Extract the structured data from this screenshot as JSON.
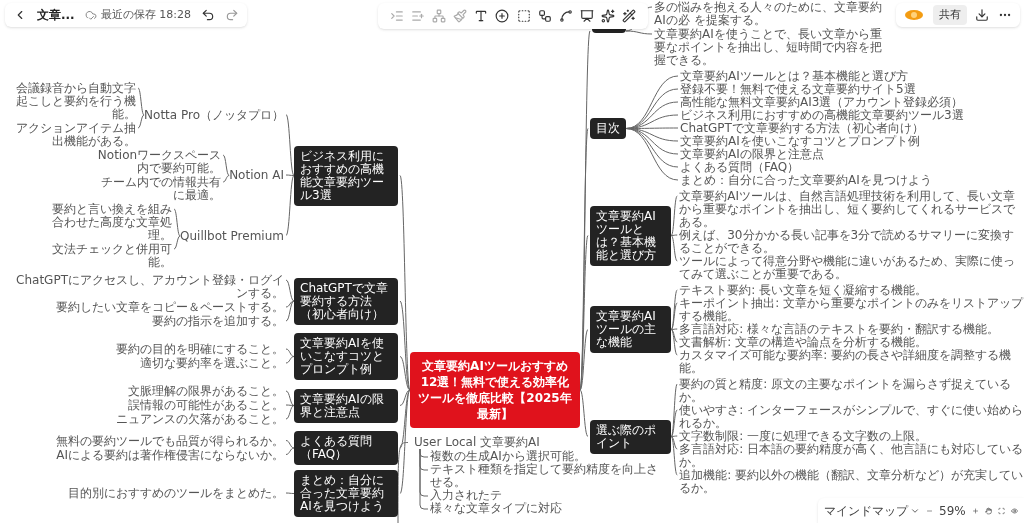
{
  "header": {
    "title": "文章...",
    "save_status": "最近の保存 18:28"
  },
  "account": {
    "share": "共有"
  },
  "mindmap": {
    "root": "文章要約AIツールおすすめ12選！無料で使える効率化ツールを徹底比較【2025年最新】",
    "right_branches": [
      {
        "leaves": [
          "多の悩みを抱える人々のために、文章要約AIの必 を提案する。",
          "文章要約AIを使うことで、長い文章から重要なポイントを抽出し、短時間で内容を把握できる。"
        ]
      },
      {
        "label": "目次",
        "leaves": [
          "文章要約AIツールとは？基本機能と選び方",
          "登録不要！無料で使える文章要約サイト5選",
          "高性能な無料文章要約AI3選（アカウント登録必須）",
          "ビジネス利用におすすめの高機能文章要約ツール3選",
          "ChatGPTで文章要約する方法（初心者向け）",
          "文章要約AIを使いこなすコツとプロンプト例",
          "文章要約AIの限界と注意点",
          "よくある質問（FAQ）",
          "まとめ：自分に合った文章要約AIを見つけよう"
        ]
      },
      {
        "label": "文章要約AIツールとは？基本機能と選び方",
        "leaves": [
          "文章要約AIツールは、自然言語処理技術を利用して、長い文章から重要なポイントを抽出し、短く要約してくれるサービスである。",
          "例えば、30分かかる長い記事を3分で読めるサマリーに変換することができる。",
          "ツールによって得意分野や機能に違いがあるため、実際に使ってみて選ぶことが重要である。"
        ]
      },
      {
        "label": "文章要約AIツールの主な機能",
        "leaves": [
          "テキスト要約: 長い文章を短く凝縮する機能。",
          "キーポイント抽出: 文章から重要なポイントのみをリストアップする機能。",
          "多言語対応: 様々な言語のテキストを要約・翻訳する機能。",
          "文書解析: 文章の構造や論点を分析する機能。",
          "カスタマイズ可能な要約率: 要約の長さや詳細度を調整する機能。"
        ]
      },
      {
        "label": "選ぶ際のポイント",
        "leaves": [
          "要約の質と精度: 原文の主要なポイントを漏らさず捉えているか。",
          "使いやすさ: インターフェースがシンプルで、すぐに使い始められるか。",
          "文字数制限: 一度に処理できる文字数の上限。",
          "多言語対応: 日本語の要約精度が高く、他言語にも対応しているか。",
          "追加機能: 要約以外の機能（翻訳、文章分析など）が充実しているか。"
        ]
      }
    ],
    "left_branches": [
      {
        "label": "ビジネス利用におすすめの高機能文章要約ツール3選",
        "leaves": [
          {
            "label": "Notta Pro（ノッタプロ）",
            "leaves": [
              "会議録音から自動文字起こしと要約を行う機能。",
              "アクションアイテム抽出機能がある。"
            ]
          },
          {
            "label": "Notion AI",
            "leaves": [
              "Notionワークスペース内で要約可能。",
              "チーム内での情報共有に最適。"
            ]
          },
          {
            "label": "Quillbot Premium",
            "leaves": [
              "要約と言い換えを組み合わせた高度な文章処理。",
              "文法チェックと併用可能。"
            ]
          }
        ]
      },
      {
        "label": "ChatGPTで文章要約する方法（初心者向け）",
        "leaves": [
          "ChatGPTにアクセスし、アカウント登録・ログインする。",
          "要約したい文章をコピー＆ペーストする。",
          "要約の指示を追加する。"
        ]
      },
      {
        "label": "文章要約AIを使いこなすコツとプロンプト例",
        "leaves": [
          "要約の目的を明確にすること。",
          "適切な要約率を選ぶこと。"
        ]
      },
      {
        "label": "文章要約AIの限界と注意点",
        "leaves": [
          "文脈理解の限界があること。",
          "誤情報の可能性があること。",
          "ニュアンスの欠落があること。"
        ]
      },
      {
        "label": "よくある質問（FAQ）",
        "leaves": [
          "無料の要約ツールでも品質が得られるか。",
          "AIによる要約は著作権侵害にならないか。"
        ]
      },
      {
        "label": "まとめ：自分に合った文章要約AIを見つけよう",
        "leaves": [
          "目的別におすすめのツールをまとめた。"
        ]
      }
    ],
    "partial_branch": {
      "label": "User Local 文章要約AI",
      "leaves": [
        "複数の生成AIから選択可能。",
        "テキスト種類を指定して要約精度を向上させる。",
        "入力されたテ",
        "様々な文章タイプに対応"
      ]
    }
  },
  "view_bar": {
    "mode": "マインドマップ",
    "zoom": "59%"
  }
}
